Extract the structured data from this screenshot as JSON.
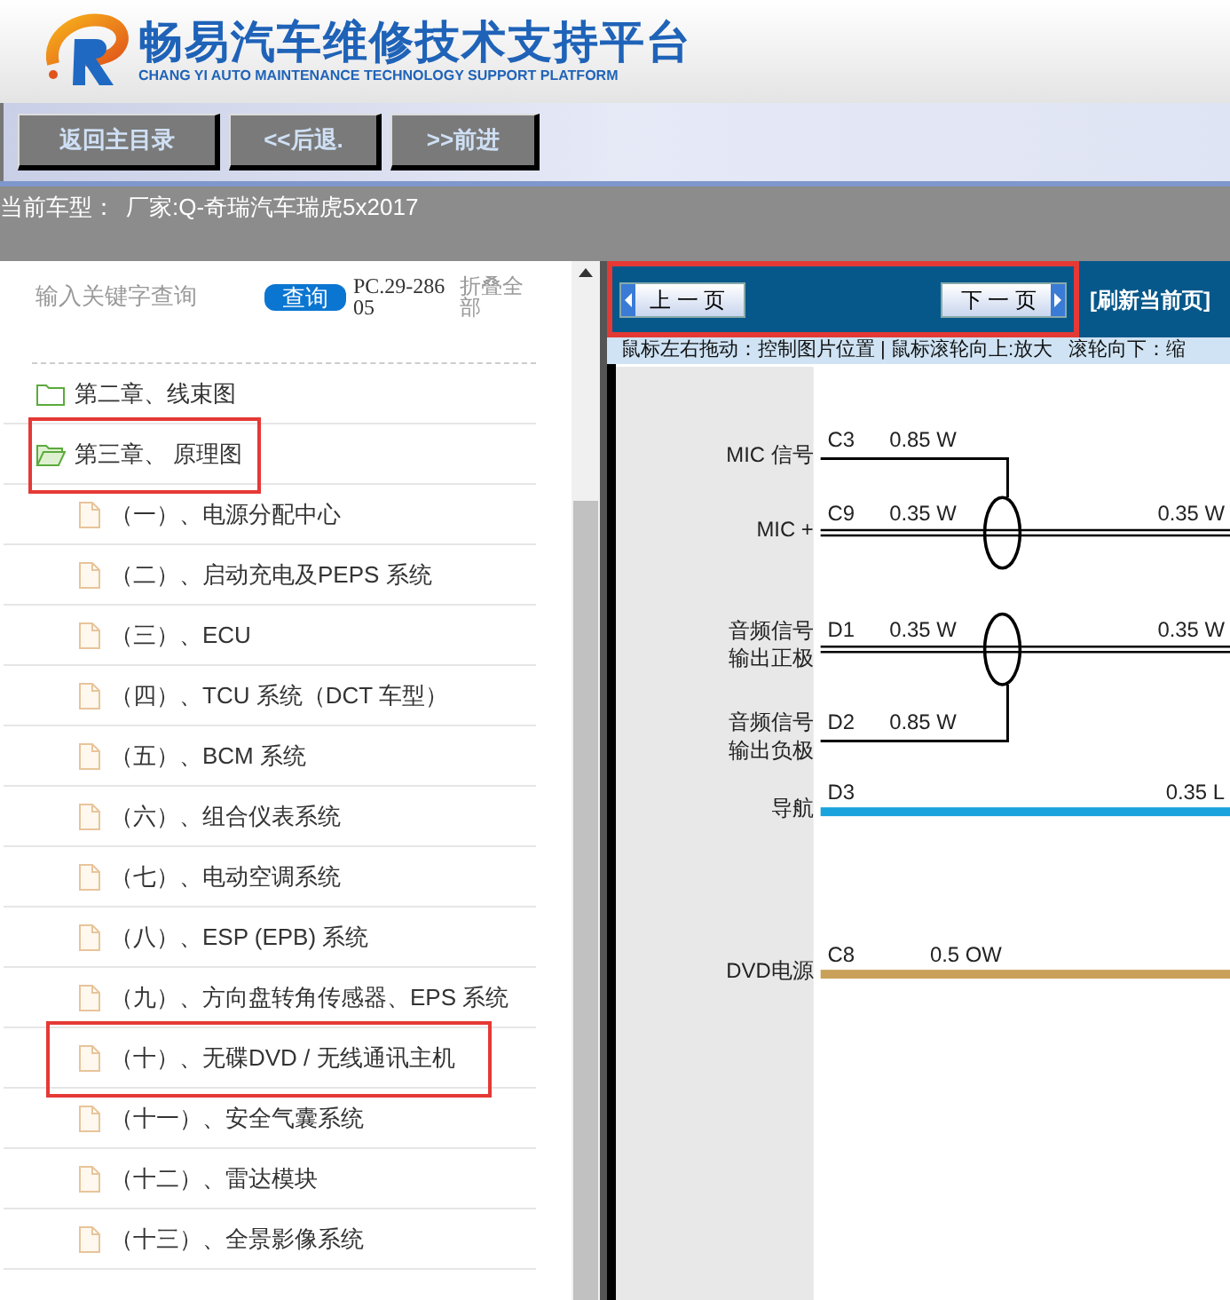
{
  "header": {
    "title": "畅易汽车维修技术支持平台",
    "subtitle": "CHANG YI AUTO MAINTENANCE TECHNOLOGY SUPPORT PLATFORM"
  },
  "toolbar": {
    "buttons": [
      "返回主目录",
      "<<后退.",
      ">>前进"
    ]
  },
  "vehicle": {
    "label": "当前车型：",
    "value": "厂家:Q-奇瑞汽车瑞虎5x2017"
  },
  "sidebar": {
    "search": {
      "placeholder": "输入关键字查询"
    },
    "search_button": "查询",
    "code": "PC.29-28605",
    "collapse_all": "折叠全部",
    "tree": [
      {
        "label": "第二章、线束图",
        "expanded": false,
        "highlighted": false
      },
      {
        "label": "第三章、 原理图",
        "expanded": true,
        "highlighted": true,
        "children": [
          {
            "label": "（一）、电源分配中心",
            "highlighted": false
          },
          {
            "label": "（二）、启动充电及PEPS 系统",
            "highlighted": false
          },
          {
            "label": "（三）、ECU",
            "highlighted": false
          },
          {
            "label": "（四）、TCU 系统（DCT 车型）",
            "highlighted": false
          },
          {
            "label": "（五）、BCM 系统",
            "highlighted": false
          },
          {
            "label": "（六）、组合仪表系统",
            "highlighted": false
          },
          {
            "label": "（七）、电动空调系统",
            "highlighted": false
          },
          {
            "label": "（八）、ESP (EPB) 系统",
            "highlighted": false
          },
          {
            "label": "（九）、方向盘转角传感器、EPS 系统",
            "highlighted": false
          },
          {
            "label": "（十）、无碟DVD / 无线通讯主机",
            "highlighted": true
          },
          {
            "label": "（十一）、安全气囊系统",
            "highlighted": false
          },
          {
            "label": "（十二）、雷达模块",
            "highlighted": false
          },
          {
            "label": "（十三）、全景影像系统",
            "highlighted": false
          }
        ]
      }
    ]
  },
  "viewer": {
    "prev": "上 一 页",
    "next": "下 一 页",
    "nav_highlighted": true,
    "refresh": "[刷新当前页]",
    "hint": "鼠标左右拖动：控制图片位置 | 鼠标滚轮向上:放大   滚轮向下：缩",
    "wires": [
      {
        "kind": "bend-down",
        "label": [
          "MIC 信号"
        ],
        "pin": "C3",
        "spec": "0.85 W",
        "color": "#000000"
      },
      {
        "kind": "shielded",
        "label": [
          "MIC +"
        ],
        "pin": "C9",
        "spec": "0.35 W",
        "spec_right": "0.35 W",
        "color": "#000000"
      },
      {
        "kind": "shielded",
        "label": [
          "音频信号",
          "输出正极"
        ],
        "pin": "D1",
        "spec": "0.35 W",
        "spec_right": "0.35 W",
        "color": "#000000"
      },
      {
        "kind": "bend-up",
        "label": [
          "音频信号",
          "输出负极"
        ],
        "pin": "D2",
        "spec": "0.85 W",
        "color": "#000000"
      },
      {
        "kind": "straight",
        "label": [
          "导航"
        ],
        "pin": "D3",
        "spec_right": "0.35 L",
        "color": "#1aa3dc"
      },
      {
        "kind": "straight",
        "label": [
          "DVD电源"
        ],
        "pin": "C8",
        "spec": "0.5 OW",
        "color": "#c9a15a"
      }
    ]
  }
}
